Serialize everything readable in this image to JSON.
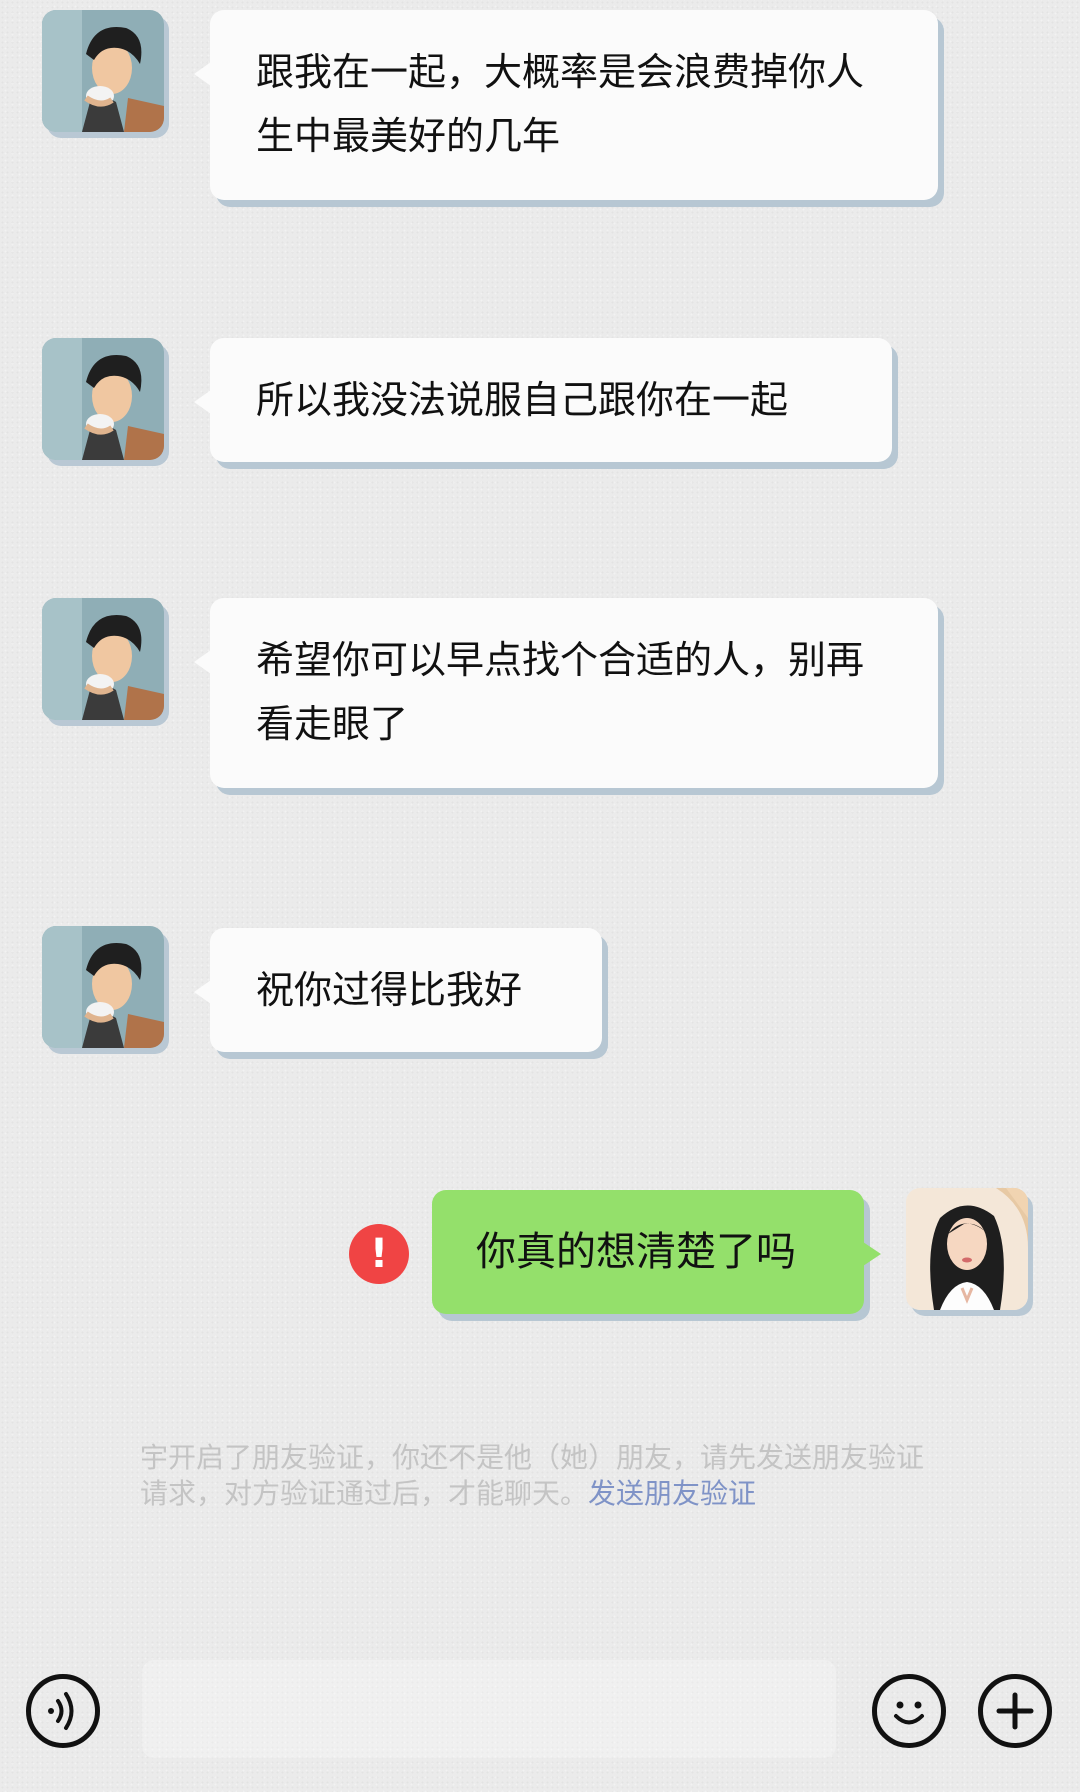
{
  "messages": [
    {
      "side": "left",
      "text": "跟我在一起，大概率是会浪费掉你人生中最美好的几年"
    },
    {
      "side": "left",
      "text": "所以我没法说服自己跟你在一起"
    },
    {
      "side": "left",
      "text": "希望你可以早点找个合适的人，别再看走眼了"
    },
    {
      "side": "left",
      "text": "祝你过得比我好"
    },
    {
      "side": "right",
      "text": "你真的想清楚了吗",
      "status": "failed"
    }
  ],
  "error_icon": {
    "glyph": "!",
    "color": "#f04444"
  },
  "system_notice": {
    "text": "宇开启了朋友验证，你还不是他（她）朋友，请先发送朋友验证请求，对方验证通过后，才能聊天。",
    "link": "发送朋友验证"
  },
  "input_bar": {
    "voice_icon": "voice-icon",
    "emoji_icon": "emoji-icon",
    "plus_icon": "plus-icon",
    "input_value": ""
  },
  "colors": {
    "background": "#ebebeb",
    "bubble_left": "#fbfbfb",
    "bubble_right": "#94e06b",
    "bubble_shadow": "#b7c7d3",
    "link": "#7f93c7"
  }
}
